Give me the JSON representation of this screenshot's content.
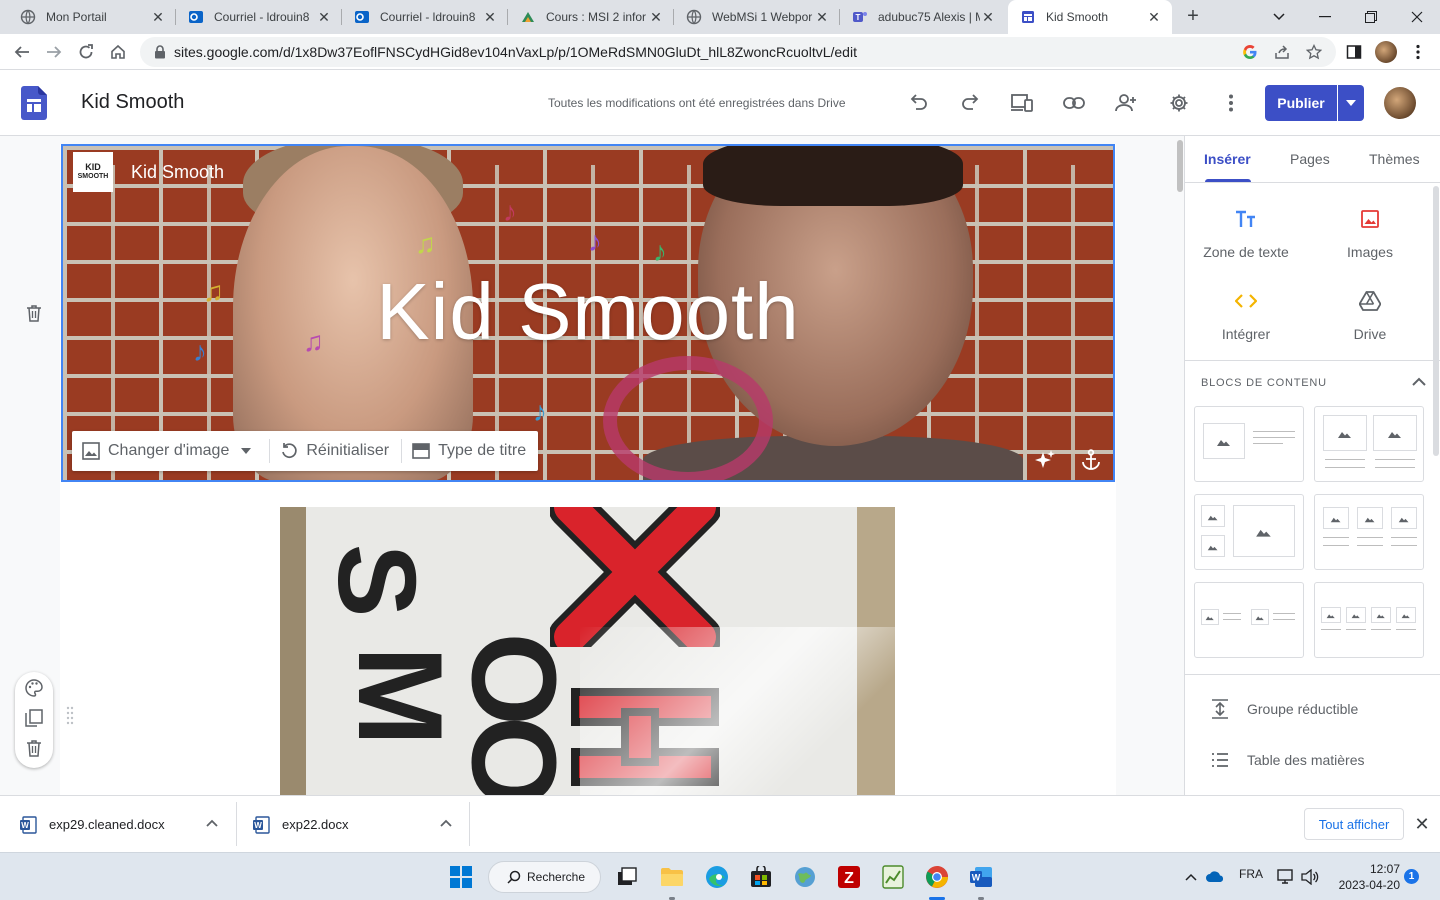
{
  "browser": {
    "tabs": [
      {
        "label": "Mon Portail",
        "icon": "globe-icon"
      },
      {
        "label": "Courriel - ldrouin8",
        "icon": "outlook-icon"
      },
      {
        "label": "Courriel - ldrouin8",
        "icon": "outlook-icon"
      },
      {
        "label": "Cours : MSI 2 infor",
        "icon": "moodle-icon"
      },
      {
        "label": "WebMSi 1 Webpor",
        "icon": "globe-icon"
      },
      {
        "label": "adubuc75 Alexis | M",
        "icon": "teams-icon"
      },
      {
        "label": "Kid Smooth",
        "icon": "google-sites-icon"
      }
    ],
    "url": "sites.google.com/d/1x8Dw37EoflFNSCydHGid8ev104nVaxLp/p/1OMeRdSMN0GluDt_hlL8ZwoncRcuoltvL/edit"
  },
  "appbar": {
    "title": "Kid Smooth",
    "saved_status": "Toutes les modifications ont été enregistrées dans Drive",
    "publish_label": "Publier"
  },
  "hero": {
    "site_logo_line1": "KID",
    "site_logo_line2": "SMOOTH",
    "site_name": "Kid Smooth",
    "title": "Kid Smooth",
    "tools": {
      "change_image": "Changer d'image",
      "reset": "Réinitialiser",
      "title_type": "Type de titre"
    }
  },
  "panel": {
    "tabs": [
      "Insérer",
      "Pages",
      "Thèmes"
    ],
    "insert_items": [
      "Zone de texte",
      "Images",
      "Intégrer",
      "Drive"
    ],
    "blocks_title": "BLOCS DE CONTENU",
    "list_items": [
      "Groupe réductible",
      "Table des matières"
    ]
  },
  "downloads": {
    "files": [
      "exp29.cleaned.docx",
      "exp22.docx"
    ],
    "show_all": "Tout afficher"
  },
  "taskbar": {
    "search": "Recherche",
    "lang": "FRA",
    "time": "12:07",
    "date": "2023-04-20",
    "notifications": "1"
  },
  "colors": {
    "accent": "#3c4fc6",
    "selection": "#4285f4"
  }
}
